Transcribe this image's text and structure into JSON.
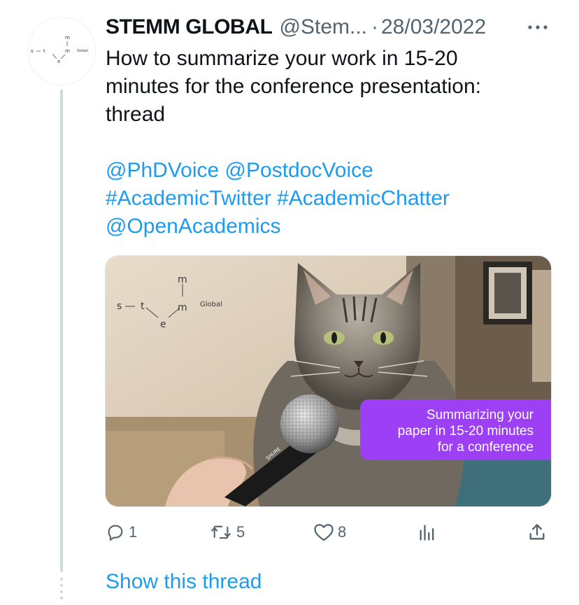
{
  "tweet": {
    "author_name": "STEMM GLOBAL",
    "author_handle": "@Stem...",
    "separator": "·",
    "date": "28/03/2022",
    "text_line1": "How to summarize your work in 15-20",
    "text_line2": "minutes for the conference presentation:",
    "text_line3": "thread",
    "mention_phdvoice": "@PhDVoice",
    "mention_postdocvoice": "@PostdocVoice",
    "hashtag_academictwitter": "#AcademicTwitter",
    "hashtag_academicchatter": "#AcademicChatter",
    "mention_openacademics": "@OpenAcademics"
  },
  "avatar_logo": {
    "letters": [
      "s",
      "t",
      "e",
      "m",
      "m"
    ],
    "suffix": "Global"
  },
  "media": {
    "logo_letters": [
      "s",
      "t",
      "e",
      "m",
      "m"
    ],
    "logo_suffix": "Global",
    "promo_line1": "Summarizing your",
    "promo_line2": "paper in 15-20 minutes",
    "promo_line3": "for a conference",
    "mic_brand": "SHURE",
    "accent_color": "#9d3ff5"
  },
  "actions": {
    "reply_count": "1",
    "retweet_count": "5",
    "like_count": "8",
    "reply_icon": "reply-icon",
    "retweet_icon": "retweet-icon",
    "like_icon": "heart-icon",
    "views_icon": "analytics-icon",
    "share_icon": "share-icon"
  },
  "show_thread_label": "Show this thread",
  "colors": {
    "link": "#1d9bf0",
    "muted": "#536471",
    "thread_line": "#cfd9de"
  }
}
